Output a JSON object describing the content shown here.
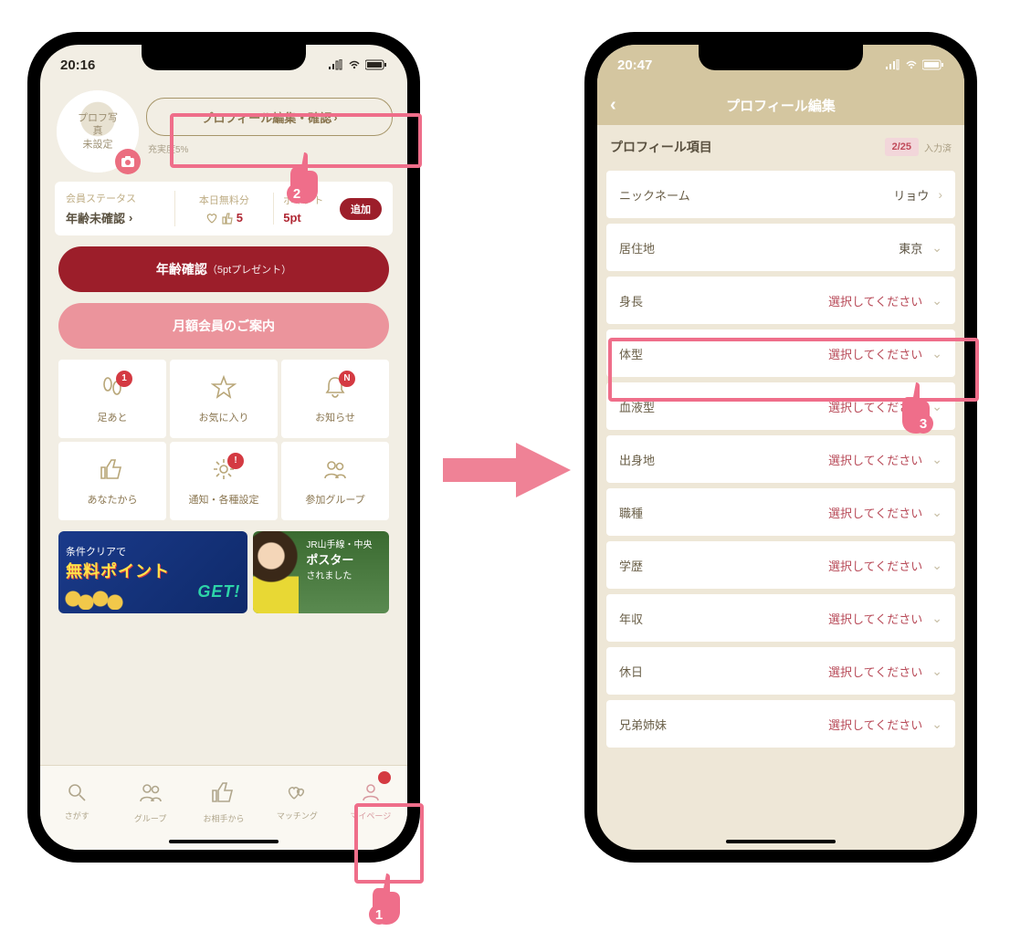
{
  "left": {
    "statusTime": "20:16",
    "avatarLabel": "プロフ写真\n未設定",
    "editButton": "プロフィール編集・確認",
    "completion": "充実度5%",
    "statusCells": {
      "memberLabel": "会員ステータス",
      "memberValue": "年齢未確認",
      "freeLabel": "本日無料分",
      "freeValue": "5",
      "pointsLabel": "ポイント",
      "pointsValue": "5pt",
      "addLabel": "追加"
    },
    "ageBtn": "年齢確認",
    "ageBtnSub": "（5ptプレゼント）",
    "monthlyBtn": "月額会員のご案内",
    "grid": [
      {
        "icon": "footprints-icon",
        "label": "足あと",
        "badge": "1"
      },
      {
        "icon": "star-icon",
        "label": "お気に入り",
        "badge": null
      },
      {
        "icon": "bell-icon",
        "label": "お知らせ",
        "badge": "N"
      },
      {
        "icon": "thumbs-up-icon",
        "label": "あなたから",
        "badge": null
      },
      {
        "icon": "gear-icon",
        "label": "通知・各種設定",
        "badge": "!"
      },
      {
        "icon": "group-icon",
        "label": "参加グループ",
        "badge": null
      }
    ],
    "banner1": {
      "line1": "条件クリアで",
      "line2": "無料ポイント",
      "line3": "GET!"
    },
    "banner2": {
      "top": "JR山手線・中央",
      "mid": "ポスター",
      "sub": "されました"
    },
    "tabs": [
      {
        "icon": "search-icon",
        "label": "さがす"
      },
      {
        "icon": "group-icon",
        "label": "グループ"
      },
      {
        "icon": "thumbs-up-icon",
        "label": "お相手から"
      },
      {
        "icon": "hearts-icon",
        "label": "マッチング"
      },
      {
        "icon": "person-icon",
        "label": "マイページ"
      }
    ]
  },
  "right": {
    "statusTime": "20:47",
    "title": "プロフィール編集",
    "sectionTitle": "プロフィール項目",
    "countChip": "2/25",
    "countSuffix": "入力済",
    "placeholder": "選択してください",
    "rows": [
      {
        "label": "ニックネーム",
        "value": "リョウ",
        "filled": true,
        "chev": ">"
      },
      {
        "label": "居住地",
        "value": "東京",
        "filled": true,
        "chev": "v"
      },
      {
        "label": "身長",
        "value": null,
        "filled": false,
        "chev": "v"
      },
      {
        "label": "体型",
        "value": null,
        "filled": false,
        "chev": "v"
      },
      {
        "label": "血液型",
        "value": null,
        "filled": false,
        "chev": "v"
      },
      {
        "label": "出身地",
        "value": null,
        "filled": false,
        "chev": "v"
      },
      {
        "label": "職種",
        "value": null,
        "filled": false,
        "chev": "v"
      },
      {
        "label": "学歴",
        "value": null,
        "filled": false,
        "chev": "v"
      },
      {
        "label": "年収",
        "value": null,
        "filled": false,
        "chev": "v"
      },
      {
        "label": "休日",
        "value": null,
        "filled": false,
        "chev": "v"
      },
      {
        "label": "兄弟姉妹",
        "value": null,
        "filled": false,
        "chev": "v"
      }
    ]
  },
  "badges": {
    "one": "1",
    "two": "2",
    "three": "3"
  }
}
